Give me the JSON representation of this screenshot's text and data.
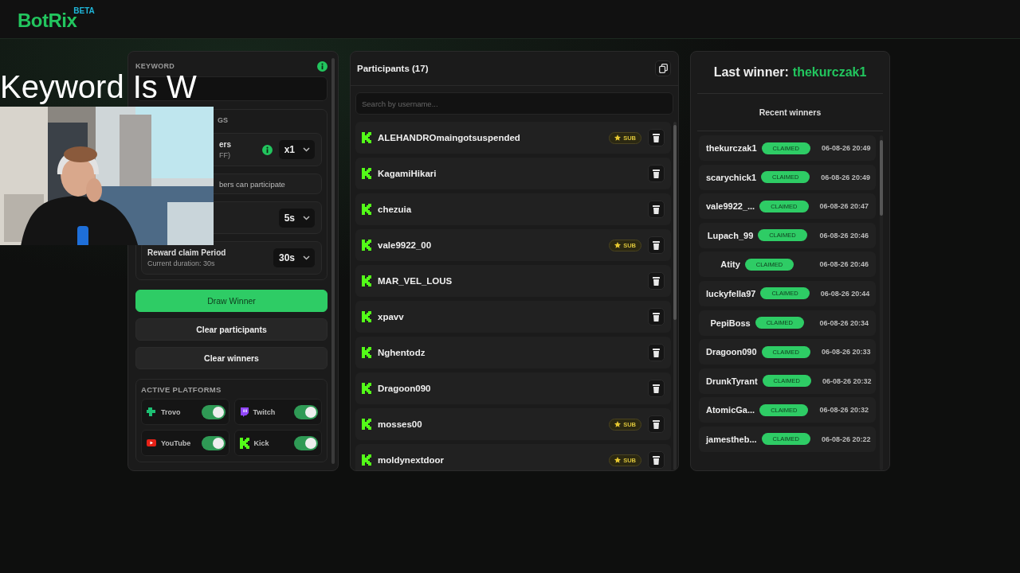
{
  "app": {
    "logo": "BotRix",
    "badge": "BETA"
  },
  "overlay_text": "Keyword Is W",
  "keyword": {
    "label": "KEYWORD"
  },
  "settings": {
    "title_fragment": "GS",
    "rows": [
      {
        "kind": "select",
        "label": "ers",
        "sub": "FF)",
        "info": true,
        "value": "x1"
      },
      {
        "kind": "note",
        "text": "bers can participate"
      },
      {
        "kind": "select",
        "value": "5s"
      },
      {
        "kind": "select",
        "label": "Reward claim Period",
        "sub": "Current duration: 30s",
        "value": "30s"
      }
    ]
  },
  "actions": [
    {
      "label": "Draw Winner",
      "primary": true
    },
    {
      "label": "Clear participants",
      "primary": false
    },
    {
      "label": "Clear winners",
      "primary": false
    }
  ],
  "platforms": {
    "title": "ACTIVE PLATFORMS",
    "items": [
      {
        "name": "Trovo",
        "kind": "trovo",
        "on": true
      },
      {
        "name": "Twitch",
        "kind": "twitch",
        "on": true
      },
      {
        "name": "YouTube",
        "kind": "youtube",
        "on": true
      },
      {
        "name": "Kick",
        "kind": "kick",
        "on": true
      }
    ]
  },
  "participants": {
    "title": "Participants (17)",
    "search_placeholder": "Search by username...",
    "items": [
      {
        "name": "ALEHANDROmaingotsuspended",
        "badge": "SUB"
      },
      {
        "name": "KagamiHikari"
      },
      {
        "name": "chezuia"
      },
      {
        "name": "vale9922_00",
        "badge": "SUB"
      },
      {
        "name": "MAR_VEL_LOUS"
      },
      {
        "name": "xpavv"
      },
      {
        "name": "Nghentodz"
      },
      {
        "name": "Dragoon090"
      },
      {
        "name": "mosses00",
        "badge": "SUB"
      },
      {
        "name": "moldynextdoor",
        "badge": "SUB"
      }
    ]
  },
  "winners": {
    "title_prefix": "Last winner:",
    "last_winner": "thekurczak1",
    "subtitle": "Recent winners",
    "items": [
      {
        "name": "thekurczak1",
        "status": "CLAIMED",
        "time": "06-08-26 20:49"
      },
      {
        "name": "scarychick1",
        "status": "CLAIMED",
        "time": "06-08-26 20:49"
      },
      {
        "name": "vale9922_...",
        "status": "CLAIMED",
        "time": "06-08-26 20:47"
      },
      {
        "name": "Lupach_99",
        "status": "CLAIMED",
        "time": "06-08-26 20:46"
      },
      {
        "name": "Atity",
        "status": "CLAIMED",
        "time": "06-08-26 20:46"
      },
      {
        "name": "luckyfella97",
        "status": "CLAIMED",
        "time": "06-08-26 20:44"
      },
      {
        "name": "PepiBoss",
        "status": "CLAIMED",
        "time": "06-08-26 20:34"
      },
      {
        "name": "Dragoon090",
        "status": "CLAIMED",
        "time": "06-08-26 20:33"
      },
      {
        "name": "DrunkTyrant",
        "status": "CLAIMED",
        "time": "06-08-26 20:32"
      },
      {
        "name": "AtomicGa...",
        "status": "CLAIMED",
        "time": "06-08-26 20:32"
      },
      {
        "name": "jamestheb...",
        "status": "CLAIMED",
        "time": "06-08-26 20:22"
      }
    ]
  }
}
